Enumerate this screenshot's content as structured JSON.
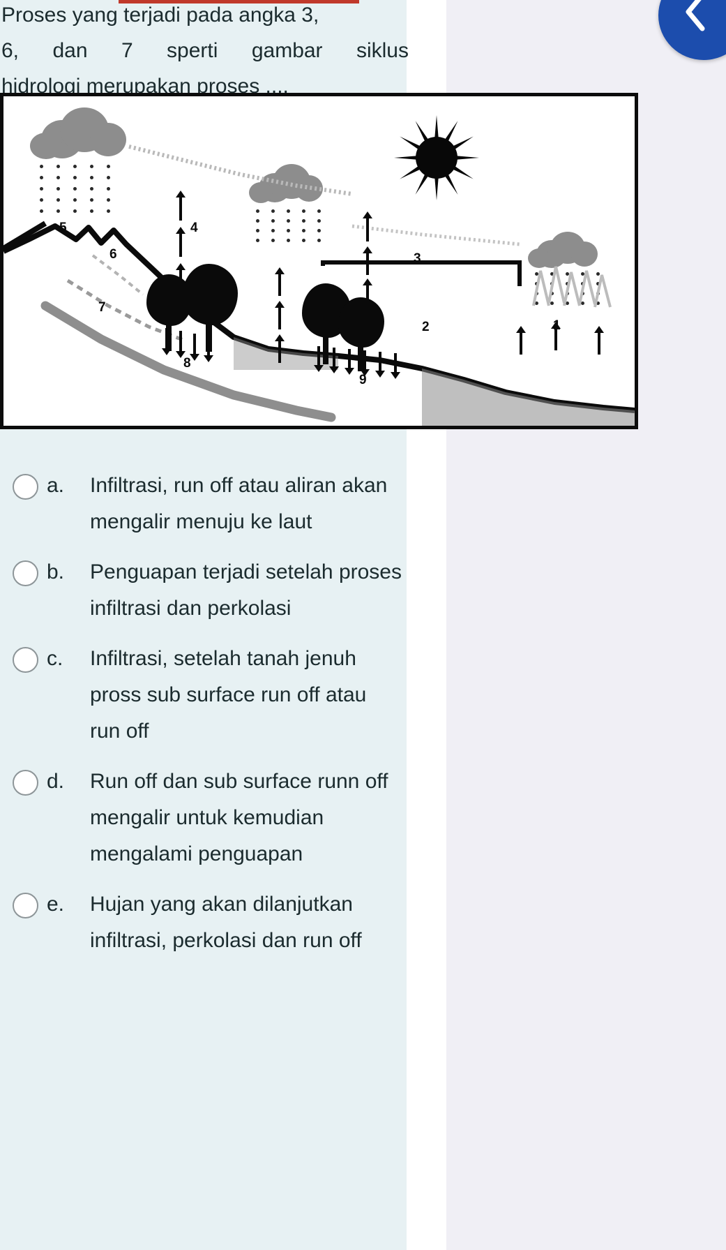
{
  "header": {
    "back_button_icon": "chevron-left-icon",
    "accent_color": "#1c4dad"
  },
  "question": {
    "line1": "Proses yang terjadi pada angka 3,",
    "line2_words": [
      "6,",
      "dan",
      "7",
      "sperti",
      "gambar",
      "siklus"
    ],
    "line3": "hidrologi merupakan proses ...."
  },
  "figure": {
    "alt": "Gambar siklus hidrologi",
    "labels": [
      "1",
      "2",
      "3",
      "4",
      "5",
      "6",
      "7",
      "8",
      "9"
    ],
    "elements": [
      "cloud",
      "rain",
      "sun",
      "mountain",
      "tree",
      "river",
      "sea",
      "arrow"
    ]
  },
  "options": [
    {
      "letter": "a.",
      "text": "Infiltrasi, run off atau aliran akan mengalir menuju ke laut",
      "selected": false
    },
    {
      "letter": "b.",
      "text": "Penguapan terjadi setelah proses infiltrasi dan perkolasi",
      "selected": false
    },
    {
      "letter": "c.",
      "text": "Infiltrasi, setelah tanah jenuh pross sub surface run off atau run off",
      "selected": false
    },
    {
      "letter": "d.",
      "text": "Run off dan sub surface runn off mengalir untuk kemudian mengalami penguapan",
      "selected": false
    },
    {
      "letter": "e.",
      "text": "Hujan yang akan dilanjutkan infiltrasi, perkolasi dan run off",
      "selected": false
    }
  ],
  "colors": {
    "card_bg": "#e7f1f3",
    "panel_bg": "#f0eff5",
    "text": "#1b2b2e",
    "radio_border": "#8d9598"
  }
}
